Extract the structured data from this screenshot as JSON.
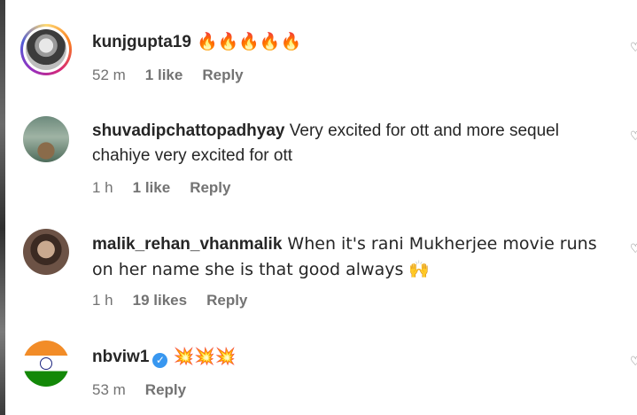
{
  "comments": [
    {
      "username": "kunjgupta19",
      "text": " 🔥🔥🔥🔥🔥",
      "time": "52 m",
      "likes": "1 like",
      "reply": "Reply"
    },
    {
      "username": "shuvadipchattopadhyay",
      "text": " Very excited for ott and more sequel chahiye very excited for ott",
      "time": "1 h",
      "likes": "1 like",
      "reply": "Reply"
    },
    {
      "username": "malik_rehan_vhanmalik",
      "text": " When it's rani Mukherjee movie runs on her name she is that good always 🙌",
      "time": "1 h",
      "likes": "19 likes",
      "reply": "Reply"
    },
    {
      "username": "nbviw1",
      "text": " 💥💥💥",
      "time": "53 m",
      "likes": "",
      "reply": "Reply"
    }
  ],
  "icons": {
    "like": "heart-icon",
    "verified": "verified-badge-icon"
  },
  "colors": {
    "text": "#262626",
    "meta": "#737373",
    "verified": "#3897f0"
  }
}
